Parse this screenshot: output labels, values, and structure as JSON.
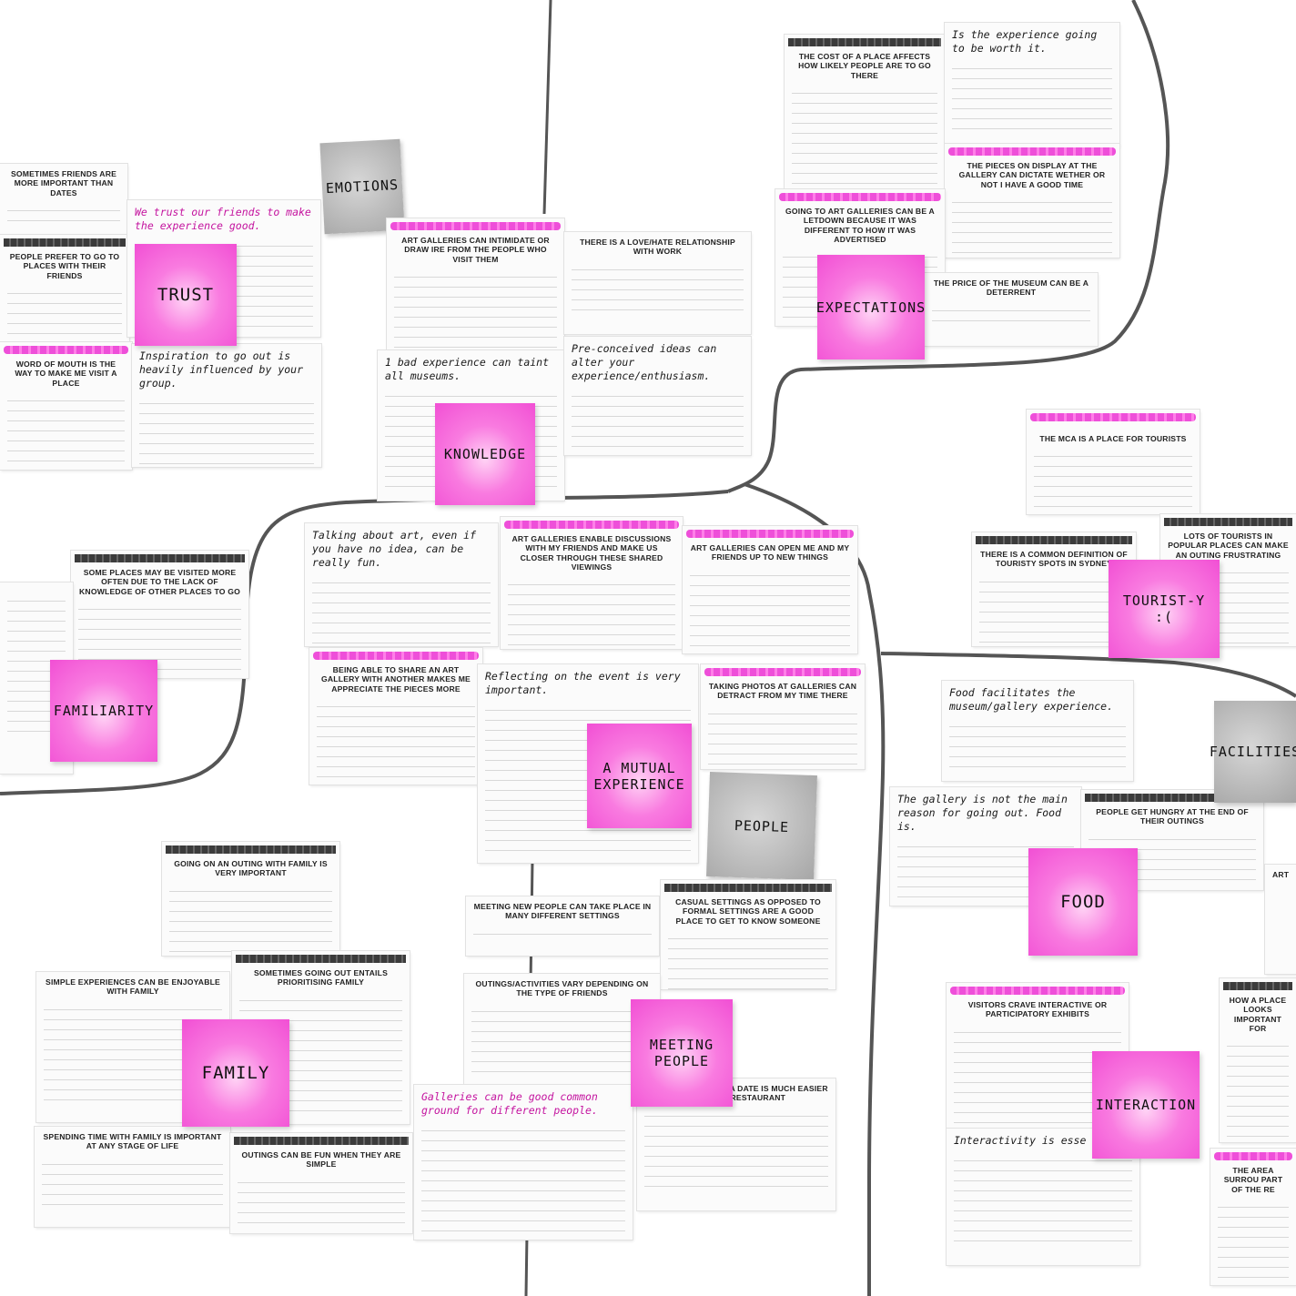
{
  "themes": {
    "trust": "TRUST",
    "knowledge": "KNOWLEDGE",
    "expectations": "EXPECTATIONS",
    "familiarity": "FAMILIARITY",
    "mutual": "A MUTUAL EXPERIENCE",
    "people": "PEOPLE",
    "emotions": "EMOTIONS",
    "touristy": "TOURIST-Y :(",
    "facilities": "FACILITIES",
    "food": "FOOD",
    "family": "FAMILY",
    "meeting": "MEETING PEOPLE",
    "interaction": "INTERACTION"
  },
  "cards": {
    "c1": "SOMETIMES FRIENDS ARE MORE IMPORTANT THAN DATES",
    "c2": "PEOPLE PREFER TO GO TO PLACES WITH THEIR FRIENDS",
    "c3": "WORD OF MOUTH IS THE WAY TO MAKE ME VISIT A PLACE",
    "c4": "We trust our friends to make the experience good.",
    "c5": "Inspiration to go out is heavily influenced by your group.",
    "c6": "ART GALLERIES CAN INTIMIDATE OR DRAW IRE FROM THE PEOPLE WHO VISIT THEM",
    "c7": "1 bad experience can taint all museums.",
    "c8": "THERE IS A LOVE/HATE RELATIONSHIP WITH WORK",
    "c9": "Pre-conceived ideas can alter your experience/enthusiasm.",
    "c10": "THE COST OF A PLACE AFFECTS HOW LIKELY PEOPLE ARE TO GO THERE",
    "c11": "Is the experience going to be worth it.",
    "c12": "THE PIECES ON DISPLAY AT THE GALLERY CAN DICTATE WETHER OR NOT I HAVE A GOOD TIME",
    "c13": "GOING TO ART GALLERIES CAN BE A LETDOWN BECAUSE IT WAS DIFFERENT TO HOW IT WAS ADVERTISED",
    "c14": "THE PRICE OF THE MUSEUM CAN BE A DETERRENT",
    "c15": "THE MCA IS A PLACE FOR TOURISTS",
    "c16": "THERE IS A COMMON DEFINITION OF TOURISTY SPOTS IN SYDNEY",
    "c17": "LOTS OF TOURISTS IN POPULAR PLACES CAN MAKE AN OUTING FRUSTRATING",
    "c18": "SOME PLACES MAY BE VISITED MORE OFTEN DUE TO THE LACK OF KNOWLEDGE OF OTHER PLACES TO GO",
    "c19": "Talking about art, even if you have no idea, can be really fun.",
    "c20": "ART GALLERIES ENABLE DISCUSSIONS WITH MY FRIENDS AND MAKE US CLOSER THROUGH THESE SHARED VIEWINGS",
    "c21": "ART GALLERIES CAN OPEN ME AND MY FRIENDS UP TO NEW THINGS",
    "c22": "BEING ABLE TO SHARE AN ART GALLERY WITH ANOTHER MAKES ME APPRECIATE THE PIECES MORE",
    "c23": "Reflecting on the event is very important.",
    "c24": "TAKING PHOTOS AT GALLERIES CAN DETRACT FROM MY TIME THERE",
    "c25": "Food facilitates the museum/gallery experience.",
    "c26": "The gallery is not the main reason for going out. Food is.",
    "c27": "PEOPLE GET HUNGRY AT THE END OF THEIR OUTINGS",
    "c28": "GOING ON AN OUTING WITH FAMILY IS VERY IMPORTANT",
    "c29": "MEETING NEW PEOPLE CAN TAKE PLACE IN MANY DIFFERENT SETTINGS",
    "c30": "CASUAL SETTINGS AS OPPOSED TO FORMAL SETTINGS ARE A GOOD PLACE TO GET TO KNOW SOMEONE",
    "c31": "SIMPLE EXPERIENCES CAN BE ENJOYABLE WITH FAMILY",
    "c32": "SOMETIMES GOING OUT ENTAILS PRIORITISING FAMILY",
    "c33": "OUTINGS/ACTIVITIES VARY DEPENDING ON THE TYPE OF FRIENDS",
    "c34": "Galleries can be good common ground for different people.",
    "c35": "GOING TO THE ... OR A DATE IS MUCH EASIER THAN THE RESTAURANT",
    "c36": "SPENDING TIME WITH FAMILY IS IMPORTANT AT ANY STAGE OF LIFE",
    "c37": "OUTINGS CAN BE FUN WHEN THEY ARE SIMPLE",
    "c38": "VISITORS CRAVE INTERACTIVE OR PARTICIPATORY EXHIBITS",
    "c39": "HOW A PLACE LOOKS IMPORTANT FOR",
    "c40": "Interactivity is esse",
    "c41": "THE AREA SURROU PART OF THE RE",
    "c42": "ART"
  },
  "colors": {
    "pink_note": "#f14fd4",
    "gray_note": "#a6a6a6",
    "marker": "#555555",
    "highlight": "#ee4fd9"
  }
}
